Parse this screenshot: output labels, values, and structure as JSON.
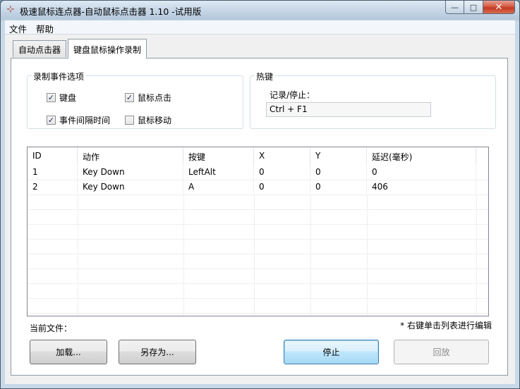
{
  "window": {
    "title": "极速鼠标连点器-自动鼠标点击器 1.10  -试用版",
    "minimize_label": "—",
    "maximize_label": "□",
    "close_label": "✕"
  },
  "menu": {
    "file": "文件",
    "help": "帮助"
  },
  "tabs": [
    {
      "label": "自动点击器"
    },
    {
      "label": "键盘鼠标操作录制"
    }
  ],
  "record_options": {
    "title": "录制事件选项",
    "items": [
      {
        "label": "键盘",
        "checked": true
      },
      {
        "label": "鼠标点击",
        "checked": true
      },
      {
        "label": "事件间隔时间",
        "checked": true
      },
      {
        "label": "鼠标移动",
        "checked": false
      }
    ]
  },
  "hotkey": {
    "title": "热键",
    "label": "记录/停止：",
    "value": "Ctrl + F1"
  },
  "table": {
    "columns": [
      "ID",
      "动作",
      "按键",
      "X",
      "Y",
      "延迟(毫秒)"
    ],
    "rows": [
      [
        "1",
        "Key Down",
        "LeftAlt",
        "0",
        "0",
        "0"
      ],
      [
        "2",
        "Key Down",
        "A",
        "0",
        "0",
        "406"
      ]
    ]
  },
  "status": {
    "current_file": "当前文件：",
    "hint": "* 右键单击列表进行编辑"
  },
  "buttons": {
    "load": "加载...",
    "save_as": "另存为...",
    "stop": "停止",
    "replay": "回放"
  },
  "colors": {
    "accent": "#3c7fb1",
    "close": "#c23b22"
  }
}
